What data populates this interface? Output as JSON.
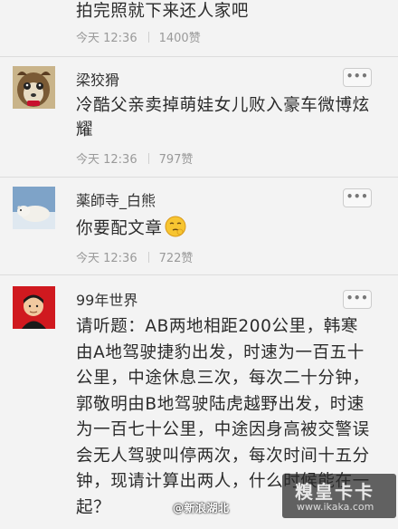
{
  "comments": [
    {
      "username": "",
      "body": "拍完照就下来还人家吧",
      "time": "今天 12:36",
      "likes": "1400赞"
    },
    {
      "username": "梁狡猾",
      "body": "冷酷父亲卖掉萌娃女儿败入豪车微博炫耀",
      "time": "今天 12:36",
      "likes": "797赞",
      "more_label": "•••"
    },
    {
      "username": "薬師寺_白熊",
      "body": "你要配文章",
      "emoji": "pondering-face-emoji",
      "time": "今天 12:36",
      "likes": "722赞",
      "more_label": "•••"
    },
    {
      "username": "99年世界",
      "body": "请听题：AB两地相距200公里，韩寒由A地驾驶捷豹出发，时速为一百五十公里，中途休息三次，每次二十分钟，郭敬明由B地驾驶陆虎越野出发，时速为一百七十公里，中途因身高被交警误会无人驾驶叫停两次，每次时间十五分钟，现请计算出两人，什么时候能在一起？",
      "more_label": "•••"
    }
  ],
  "watermark": "@新浪湖北",
  "brand": {
    "name": "糗皇卡卡",
    "url": "www.ikaka.com"
  },
  "colors": {
    "background": "#f3f3f3",
    "text": "#2b2b2b",
    "meta": "#9a9a9a"
  }
}
